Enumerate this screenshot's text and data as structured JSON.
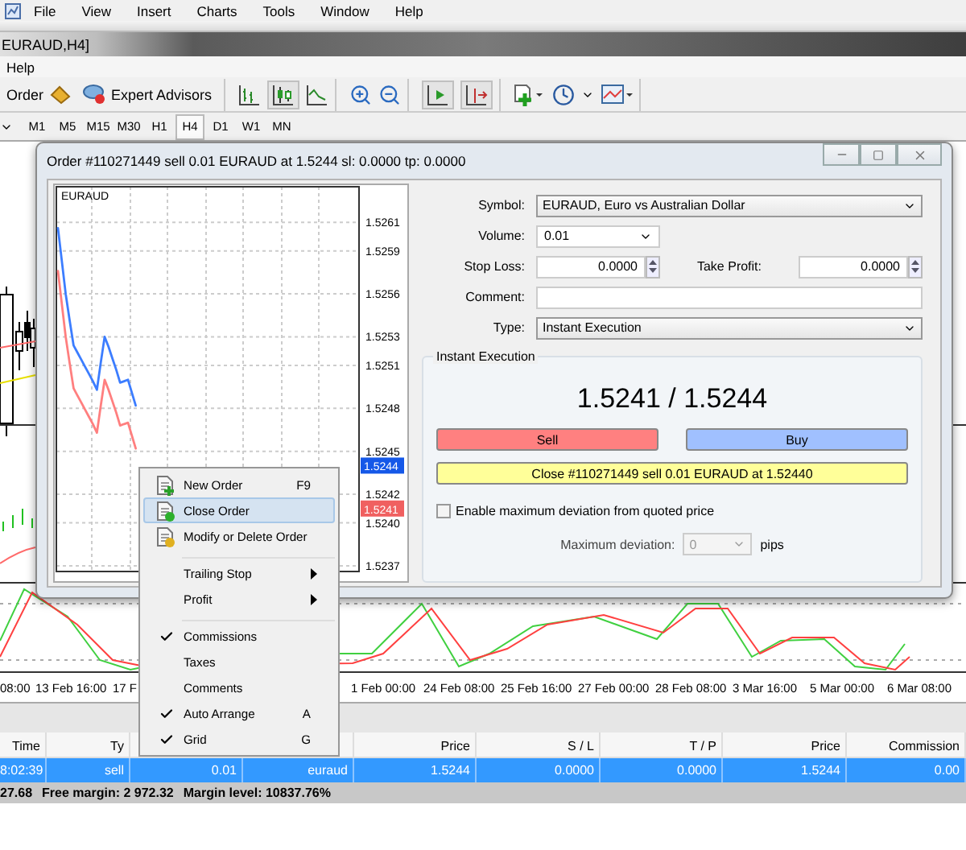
{
  "menu_bar": [
    "File",
    "View",
    "Insert",
    "Charts",
    "Tools",
    "Window",
    "Help"
  ],
  "window_title": "EURAUD,H4]",
  "secondary_menu": [
    "Help"
  ],
  "toolbar": {
    "order_label": "Order",
    "expert_advisors": "Expert Advisors"
  },
  "timeframes": [
    {
      "label": "M1",
      "selected": false
    },
    {
      "label": "M5",
      "selected": false
    },
    {
      "label": "M15",
      "selected": false
    },
    {
      "label": "M30",
      "selected": false
    },
    {
      "label": "H1",
      "selected": false
    },
    {
      "label": "H4",
      "selected": true
    },
    {
      "label": "D1",
      "selected": false
    },
    {
      "label": "W1",
      "selected": false
    },
    {
      "label": "MN",
      "selected": false
    }
  ],
  "order_dialog": {
    "title": "Order #110271449 sell 0.01 EURAUD at 1.5244 sl: 0.0000 tp: 0.0000",
    "chart": {
      "symbol": "EURAUD",
      "price_tags": [
        {
          "label": "1.5244",
          "color": "#1558e8"
        },
        {
          "label": "1.5241",
          "color": "#f06060"
        }
      ],
      "chart_data": {
        "type": "line",
        "ylim": [
          1.52366,
          1.52636
        ],
        "grid": true,
        "yticks": [
          {
            "value": 1.5261,
            "label": "1.5261"
          },
          {
            "value": 1.5259,
            "label": "1.5259"
          },
          {
            "value": 1.5256,
            "label": "1.5256"
          },
          {
            "value": 1.5253,
            "label": "1.5253"
          },
          {
            "value": 1.5251,
            "label": "1.5251"
          },
          {
            "value": 1.5248,
            "label": "1.5248"
          },
          {
            "value": 1.5245,
            "label": "1.5245"
          },
          {
            "value": 1.5242,
            "label": "1.5242"
          },
          {
            "value": 1.524,
            "label": "1.5240"
          },
          {
            "value": 1.5237,
            "label": "1.5237"
          }
        ],
        "series": [
          {
            "color": "#3c7dff",
            "values": [
              1.52606,
              1.52583,
              1.5256,
              1.52542,
              1.52524,
              1.52519,
              1.52514,
              1.52509,
              1.52504,
              1.52499,
              1.52493,
              1.52512,
              1.5253,
              1.52523,
              1.52515,
              1.52507,
              1.52498,
              1.52499,
              1.525,
              1.52491,
              1.52482,
              null,
              null,
              null,
              null,
              null,
              null,
              null,
              null,
              null,
              null,
              null,
              null,
              null,
              null,
              null,
              null,
              null,
              null,
              null,
              null,
              null,
              null,
              null,
              null,
              null,
              null,
              null,
              null,
              null,
              null,
              null,
              null,
              null,
              null,
              null,
              null,
              null,
              null,
              null,
              null,
              null,
              null,
              null,
              null,
              null,
              null,
              null,
              null,
              null,
              null,
              null,
              null,
              null,
              null,
              null,
              null,
              null
            ]
          },
          {
            "color": "#ff7f7f",
            "values": [
              1.52576,
              1.52553,
              1.5253,
              1.52512,
              1.52494,
              1.52489,
              1.52484,
              1.52479,
              1.52474,
              1.52469,
              1.52463,
              1.52482,
              1.525,
              1.52493,
              1.52485,
              1.52477,
              1.52468,
              1.52469,
              1.5247,
              1.52461,
              1.52452,
              null,
              null,
              null,
              null,
              null,
              null,
              null,
              null,
              null,
              null,
              null,
              null,
              null,
              null,
              null,
              null,
              null,
              null,
              null,
              null,
              null,
              null,
              null,
              null,
              null,
              null,
              null,
              null,
              null,
              null,
              null,
              null,
              null,
              null,
              null,
              null,
              null,
              null,
              null,
              null,
              null,
              null,
              null,
              null,
              null,
              null,
              null,
              null,
              null,
              null,
              null,
              null,
              null,
              null,
              null,
              null,
              null
            ]
          }
        ]
      }
    },
    "symbol": {
      "label": "Symbol:",
      "value": "EURAUD, Euro vs Australian Dollar"
    },
    "volume": {
      "label": "Volume:",
      "value": "0.01"
    },
    "stop_loss": {
      "label": "Stop Loss:",
      "value": "0.0000"
    },
    "take_profit": {
      "label": "Take Profit:",
      "value": "0.0000"
    },
    "comment": {
      "label": "Comment:"
    },
    "type": {
      "label": "Type:",
      "value": "Instant Execution"
    },
    "execution": {
      "title": "Instant Execution",
      "quote": "1.5241 / 1.5244",
      "sell": "Sell",
      "buy": "Buy",
      "close": "Close #110271449 sell 0.01 EURAUD at 1.52440",
      "deviation_check": {
        "label": "Enable maximum deviation from quoted price",
        "checked": false
      },
      "max_deviation": {
        "label": "Maximum deviation:",
        "value": "0",
        "unit": "pips",
        "disabled": true
      }
    }
  },
  "context_menu": {
    "items": [
      {
        "kind": "command",
        "label": "New Order",
        "shortcut": "F9",
        "selected": false
      },
      {
        "kind": "command",
        "label": "Close Order",
        "selected": true
      },
      {
        "kind": "command",
        "label": "Modify or Delete Order",
        "selected": false
      },
      {
        "kind": "separator"
      },
      {
        "kind": "submenu",
        "label": "Trailing Stop"
      },
      {
        "kind": "submenu",
        "label": "Profit"
      },
      {
        "kind": "separator"
      },
      {
        "kind": "check",
        "label": "Commissions",
        "checked": true
      },
      {
        "kind": "check",
        "label": "Taxes",
        "checked": false
      },
      {
        "kind": "check",
        "label": "Comments",
        "checked": false
      },
      {
        "kind": "check",
        "label": "Auto Arrange",
        "shortcut": "A",
        "checked": true
      },
      {
        "kind": "check",
        "label": "Grid",
        "shortcut": "G",
        "checked": true
      }
    ]
  },
  "time_axis": [
    "08:00",
    "13 Feb 16:00",
    "17 F",
    "1 Feb 00:00",
    "24 Feb 08:00",
    "25 Feb 16:00",
    "27 Feb 00:00",
    "28 Feb 08:00",
    "3 Mar 16:00",
    "5 Mar 00:00",
    "6 Mar 08:00"
  ],
  "trade_table": {
    "columns": [
      "Time",
      "Ty",
      "",
      "",
      "Price",
      "S / L",
      "T / P",
      "Price",
      "Commission"
    ],
    "rows": [
      {
        "selected": true,
        "cells": [
          "8:02:39",
          "sell",
          "0.01",
          "euraud",
          "1.5244",
          "0.0000",
          "0.0000",
          "1.5244",
          "0.00"
        ]
      }
    ]
  },
  "status_bar": [
    "27.68",
    "Free margin: 2 972.32",
    "Margin level: 10837.76%"
  ]
}
